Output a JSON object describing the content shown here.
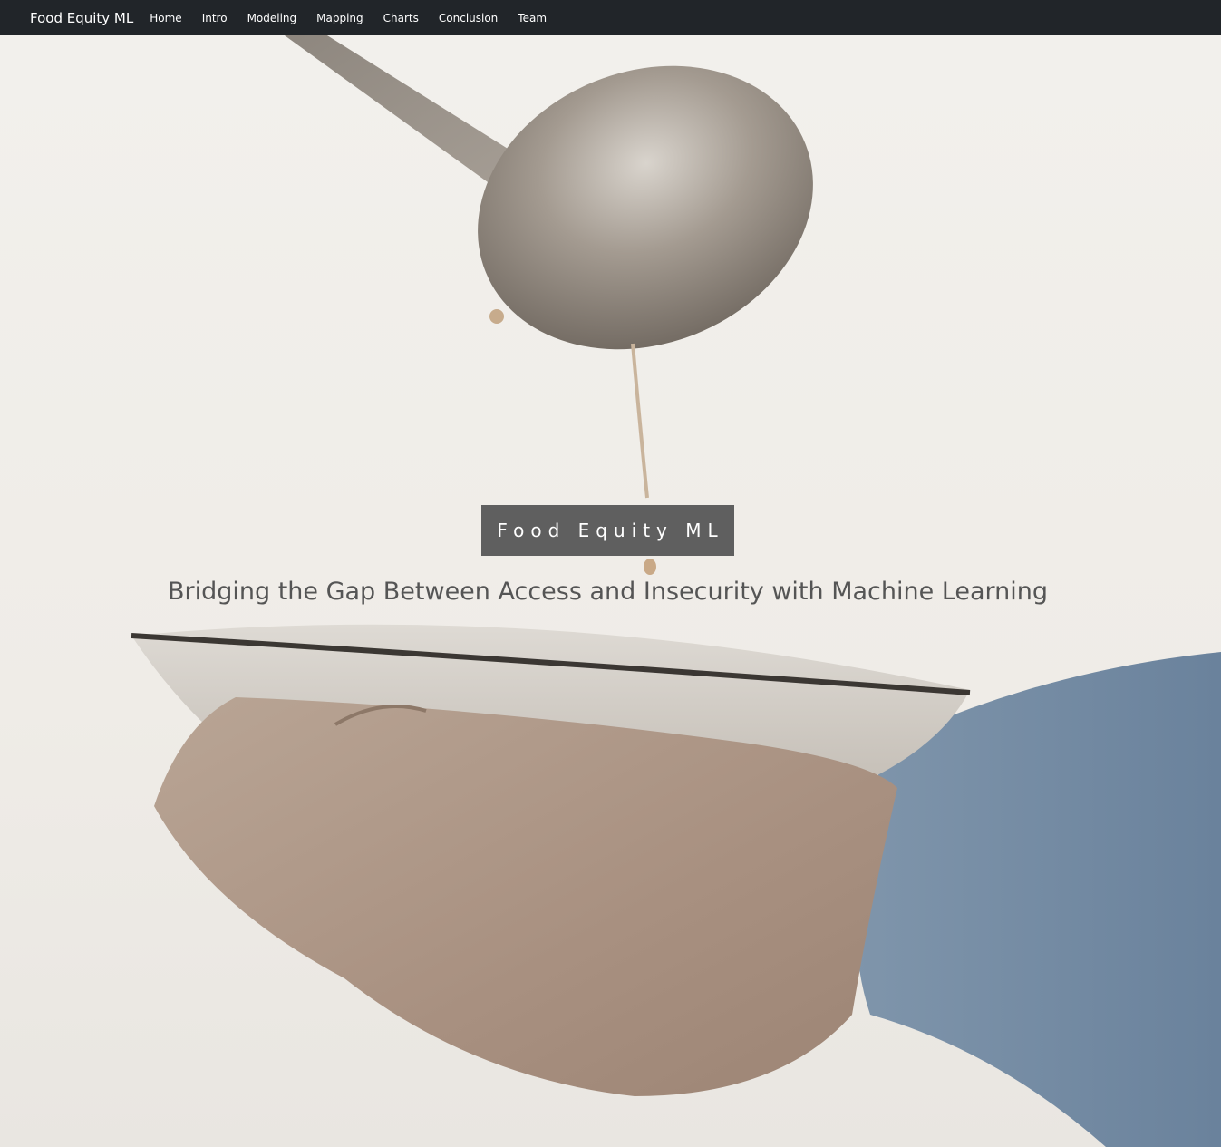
{
  "navbar": {
    "brand": "Food Equity ML",
    "items": [
      {
        "label": "Home"
      },
      {
        "label": "Intro"
      },
      {
        "label": "Modeling"
      },
      {
        "label": "Mapping"
      },
      {
        "label": "Charts"
      },
      {
        "label": "Conclusion"
      },
      {
        "label": "Team"
      }
    ]
  },
  "hero": {
    "title": "Food Equity ML",
    "subtitle": "Bridging the Gap Between Access and Insecurity with Machine Learning",
    "background_image": "ladle-pouring-soup-into-bowl-held-by-hands"
  },
  "colors": {
    "navbar_bg": "#212529",
    "badge_bg": "#5f5f5f",
    "subtitle_text": "#555555"
  }
}
